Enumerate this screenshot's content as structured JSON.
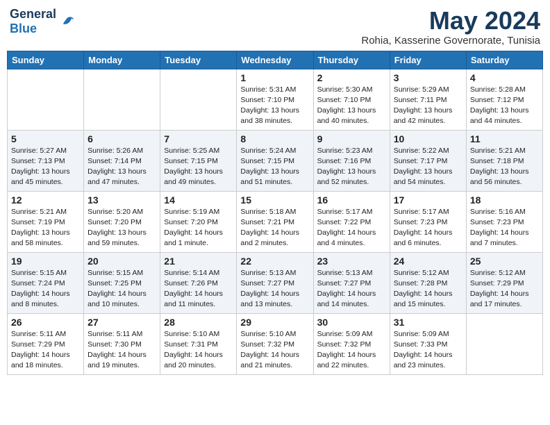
{
  "header": {
    "logo_general": "General",
    "logo_blue": "Blue",
    "month_year": "May 2024",
    "location": "Rohia, Kasserine Governorate, Tunisia"
  },
  "weekdays": [
    "Sunday",
    "Monday",
    "Tuesday",
    "Wednesday",
    "Thursday",
    "Friday",
    "Saturday"
  ],
  "weeks": [
    [
      {
        "day": "",
        "sunrise": "",
        "sunset": "",
        "daylight": ""
      },
      {
        "day": "",
        "sunrise": "",
        "sunset": "",
        "daylight": ""
      },
      {
        "day": "",
        "sunrise": "",
        "sunset": "",
        "daylight": ""
      },
      {
        "day": "1",
        "sunrise": "Sunrise: 5:31 AM",
        "sunset": "Sunset: 7:10 PM",
        "daylight": "Daylight: 13 hours and 38 minutes."
      },
      {
        "day": "2",
        "sunrise": "Sunrise: 5:30 AM",
        "sunset": "Sunset: 7:10 PM",
        "daylight": "Daylight: 13 hours and 40 minutes."
      },
      {
        "day": "3",
        "sunrise": "Sunrise: 5:29 AM",
        "sunset": "Sunset: 7:11 PM",
        "daylight": "Daylight: 13 hours and 42 minutes."
      },
      {
        "day": "4",
        "sunrise": "Sunrise: 5:28 AM",
        "sunset": "Sunset: 7:12 PM",
        "daylight": "Daylight: 13 hours and 44 minutes."
      }
    ],
    [
      {
        "day": "5",
        "sunrise": "Sunrise: 5:27 AM",
        "sunset": "Sunset: 7:13 PM",
        "daylight": "Daylight: 13 hours and 45 minutes."
      },
      {
        "day": "6",
        "sunrise": "Sunrise: 5:26 AM",
        "sunset": "Sunset: 7:14 PM",
        "daylight": "Daylight: 13 hours and 47 minutes."
      },
      {
        "day": "7",
        "sunrise": "Sunrise: 5:25 AM",
        "sunset": "Sunset: 7:15 PM",
        "daylight": "Daylight: 13 hours and 49 minutes."
      },
      {
        "day": "8",
        "sunrise": "Sunrise: 5:24 AM",
        "sunset": "Sunset: 7:15 PM",
        "daylight": "Daylight: 13 hours and 51 minutes."
      },
      {
        "day": "9",
        "sunrise": "Sunrise: 5:23 AM",
        "sunset": "Sunset: 7:16 PM",
        "daylight": "Daylight: 13 hours and 52 minutes."
      },
      {
        "day": "10",
        "sunrise": "Sunrise: 5:22 AM",
        "sunset": "Sunset: 7:17 PM",
        "daylight": "Daylight: 13 hours and 54 minutes."
      },
      {
        "day": "11",
        "sunrise": "Sunrise: 5:21 AM",
        "sunset": "Sunset: 7:18 PM",
        "daylight": "Daylight: 13 hours and 56 minutes."
      }
    ],
    [
      {
        "day": "12",
        "sunrise": "Sunrise: 5:21 AM",
        "sunset": "Sunset: 7:19 PM",
        "daylight": "Daylight: 13 hours and 58 minutes."
      },
      {
        "day": "13",
        "sunrise": "Sunrise: 5:20 AM",
        "sunset": "Sunset: 7:20 PM",
        "daylight": "Daylight: 13 hours and 59 minutes."
      },
      {
        "day": "14",
        "sunrise": "Sunrise: 5:19 AM",
        "sunset": "Sunset: 7:20 PM",
        "daylight": "Daylight: 14 hours and 1 minute."
      },
      {
        "day": "15",
        "sunrise": "Sunrise: 5:18 AM",
        "sunset": "Sunset: 7:21 PM",
        "daylight": "Daylight: 14 hours and 2 minutes."
      },
      {
        "day": "16",
        "sunrise": "Sunrise: 5:17 AM",
        "sunset": "Sunset: 7:22 PM",
        "daylight": "Daylight: 14 hours and 4 minutes."
      },
      {
        "day": "17",
        "sunrise": "Sunrise: 5:17 AM",
        "sunset": "Sunset: 7:23 PM",
        "daylight": "Daylight: 14 hours and 6 minutes."
      },
      {
        "day": "18",
        "sunrise": "Sunrise: 5:16 AM",
        "sunset": "Sunset: 7:23 PM",
        "daylight": "Daylight: 14 hours and 7 minutes."
      }
    ],
    [
      {
        "day": "19",
        "sunrise": "Sunrise: 5:15 AM",
        "sunset": "Sunset: 7:24 PM",
        "daylight": "Daylight: 14 hours and 8 minutes."
      },
      {
        "day": "20",
        "sunrise": "Sunrise: 5:15 AM",
        "sunset": "Sunset: 7:25 PM",
        "daylight": "Daylight: 14 hours and 10 minutes."
      },
      {
        "day": "21",
        "sunrise": "Sunrise: 5:14 AM",
        "sunset": "Sunset: 7:26 PM",
        "daylight": "Daylight: 14 hours and 11 minutes."
      },
      {
        "day": "22",
        "sunrise": "Sunrise: 5:13 AM",
        "sunset": "Sunset: 7:27 PM",
        "daylight": "Daylight: 14 hours and 13 minutes."
      },
      {
        "day": "23",
        "sunrise": "Sunrise: 5:13 AM",
        "sunset": "Sunset: 7:27 PM",
        "daylight": "Daylight: 14 hours and 14 minutes."
      },
      {
        "day": "24",
        "sunrise": "Sunrise: 5:12 AM",
        "sunset": "Sunset: 7:28 PM",
        "daylight": "Daylight: 14 hours and 15 minutes."
      },
      {
        "day": "25",
        "sunrise": "Sunrise: 5:12 AM",
        "sunset": "Sunset: 7:29 PM",
        "daylight": "Daylight: 14 hours and 17 minutes."
      }
    ],
    [
      {
        "day": "26",
        "sunrise": "Sunrise: 5:11 AM",
        "sunset": "Sunset: 7:29 PM",
        "daylight": "Daylight: 14 hours and 18 minutes."
      },
      {
        "day": "27",
        "sunrise": "Sunrise: 5:11 AM",
        "sunset": "Sunset: 7:30 PM",
        "daylight": "Daylight: 14 hours and 19 minutes."
      },
      {
        "day": "28",
        "sunrise": "Sunrise: 5:10 AM",
        "sunset": "Sunset: 7:31 PM",
        "daylight": "Daylight: 14 hours and 20 minutes."
      },
      {
        "day": "29",
        "sunrise": "Sunrise: 5:10 AM",
        "sunset": "Sunset: 7:32 PM",
        "daylight": "Daylight: 14 hours and 21 minutes."
      },
      {
        "day": "30",
        "sunrise": "Sunrise: 5:09 AM",
        "sunset": "Sunset: 7:32 PM",
        "daylight": "Daylight: 14 hours and 22 minutes."
      },
      {
        "day": "31",
        "sunrise": "Sunrise: 5:09 AM",
        "sunset": "Sunset: 7:33 PM",
        "daylight": "Daylight: 14 hours and 23 minutes."
      },
      {
        "day": "",
        "sunrise": "",
        "sunset": "",
        "daylight": ""
      }
    ]
  ]
}
